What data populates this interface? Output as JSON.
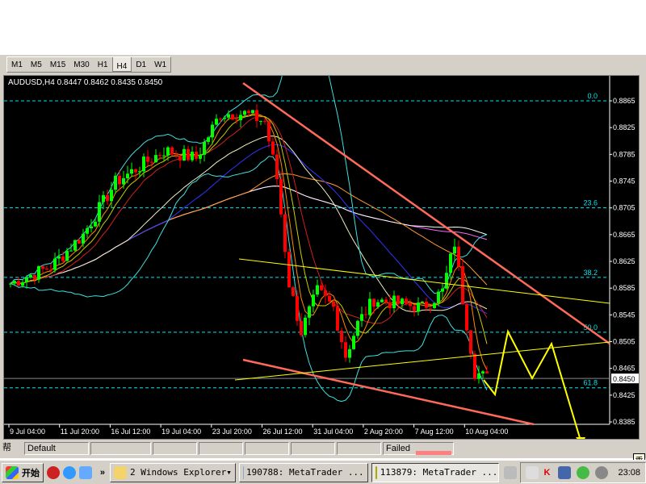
{
  "timeframes": [
    "M1",
    "M5",
    "M15",
    "M30",
    "H1",
    "H4",
    "D1",
    "W1"
  ],
  "active_timeframe": "H4",
  "chart_header": "AUDUSD,H4  0.8447 0.8462 0.8435 0.8450",
  "current_price": "0.8450",
  "price_axis": [
    "0.8865",
    "0.8825",
    "0.8785",
    "0.8745",
    "0.8705",
    "0.8665",
    "0.8625",
    "0.8585",
    "0.8545",
    "0.8505",
    "0.8465",
    "0.8425",
    "0.8385"
  ],
  "time_axis": [
    "9 Jul 04:00",
    "11 Jul 20:00",
    "16 Jul 12:00",
    "19 Jul 04:00",
    "23 Jul 20:00",
    "26 Jul 12:00",
    "31 Jul 04:00",
    "2 Aug 20:00",
    "7 Aug 12:00",
    "10 Aug 04:00"
  ],
  "fib_levels": [
    {
      "label": "0.0",
      "price": 0.8865
    },
    {
      "label": "23.6",
      "price": 0.8705
    },
    {
      "label": "38.2",
      "price": 0.8601
    },
    {
      "label": "50.0",
      "price": 0.8519
    },
    {
      "label": "61.8",
      "price": 0.8436
    }
  ],
  "chart_data": {
    "type": "candlestick",
    "symbol": "AUDUSD",
    "timeframe": "H4",
    "ylim": [
      0.8375,
      0.89
    ],
    "close_keypoints": [
      [
        0,
        0.8592
      ],
      [
        10,
        0.8617
      ],
      [
        18,
        0.8665
      ],
      [
        26,
        0.8743
      ],
      [
        38,
        0.8791
      ],
      [
        46,
        0.8779
      ],
      [
        52,
        0.8846
      ],
      [
        58,
        0.8846
      ],
      [
        63,
        0.8834
      ],
      [
        66,
        0.8749
      ],
      [
        69,
        0.8592
      ],
      [
        72,
        0.852
      ],
      [
        76,
        0.858
      ],
      [
        80,
        0.8556
      ],
      [
        83,
        0.8484
      ],
      [
        86,
        0.8532
      ],
      [
        90,
        0.8568
      ],
      [
        96,
        0.8562
      ],
      [
        102,
        0.8556
      ],
      [
        107,
        0.858
      ],
      [
        110,
        0.8653
      ],
      [
        112,
        0.8568
      ],
      [
        115,
        0.846
      ],
      [
        118,
        0.845
      ]
    ]
  },
  "status_bar": {
    "profile": "Default",
    "connection": "Failed",
    "help_glyph": "帮"
  },
  "taskbar": {
    "start": "开始",
    "chevron": "»",
    "items": [
      "2 Windows Explorer",
      "190788: MetaTrader ...",
      "113879: MetaTrader ..."
    ],
    "clock": "23:08",
    "ime": "垂"
  },
  "colors": {
    "bull": "#00ff00",
    "bear": "#ff0000",
    "fib": "#00e5ee",
    "trend_red": "#ff6a5a",
    "trend_yellow": "#ffff00"
  }
}
